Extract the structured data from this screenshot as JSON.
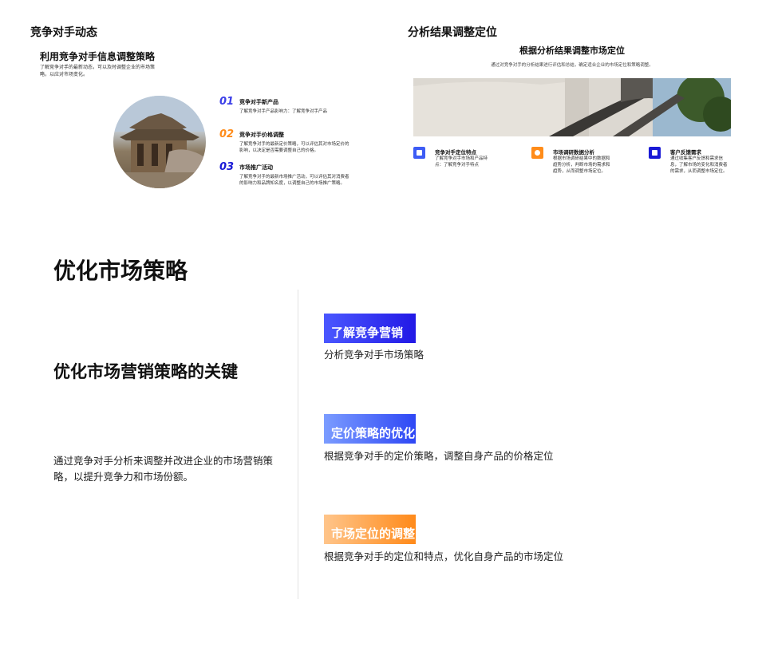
{
  "slide1": {
    "heading": "竞争对手动态",
    "title": "利用竞争对手信息调整策略",
    "description": "了解竞争对手的最新动态，可以及时调整企业的市场策略，以应对市场变化。",
    "items": [
      {
        "number": "01",
        "title": "竞争对手新产品",
        "text": "了解竞争对手产品影响力：了解竞争对手产品",
        "color": "#3b3ee8"
      },
      {
        "number": "02",
        "title": "竞争对手价格调整",
        "text": "了解竞争对手的最新定价策略，可以评估其对市场定价的影响，以决定是否需要调整自己的价格。",
        "color": "#ff8c1a"
      },
      {
        "number": "03",
        "title": "市场推广活动",
        "text": "了解竞争对手的最新市场推广活动，可以评估其对消费者的影响力和品牌知名度，以调整自己的市场推广策略。",
        "color": "#1a1ad6"
      }
    ]
  },
  "slide2": {
    "heading": "分析结果调整定位",
    "title": "根据分析结果调整市场定位",
    "subtitle": "通过对竞争对手的分析结果进行评估和总结，确定适合企业的市场定位和策略调整。",
    "cards": [
      {
        "icon": "image-icon",
        "title": "竞争对手定位特点",
        "text": "了解竞争对手市场和产品特点：了解竞争对手特点",
        "color": "#3d5cf5"
      },
      {
        "icon": "gear-icon",
        "title": "市场调研数据分析",
        "text": "根据市场调研结果中的数据和趋势分析，判断市场的需求和趋势，从而调整市场定位。",
        "color": "#ff8c1a"
      },
      {
        "icon": "chat-icon",
        "title": "客户反馈需求",
        "text": "通过收集客户反馈和需求信息，了解市场的变化和消费者的需求，从而调整市场定位。",
        "color": "#1a1ad6"
      }
    ]
  },
  "slide3": {
    "heading": "优化市场策略",
    "key_title": "优化市场营销策略的关键",
    "description": "通过竞争对手分析来调整并改进企业的市场营销策略，以提升竞争力和市场份额。",
    "points": [
      {
        "tag": "了解竞争营销",
        "text": "分析竞争对手市场策略"
      },
      {
        "tag": "定价策略的优化",
        "text": "根据竞争对手的定价策略，调整自身产品的价格定位"
      },
      {
        "tag": "市场定位的调整",
        "text": "根据竞争对手的定位和特点，优化自身产品的市场定位"
      }
    ]
  }
}
